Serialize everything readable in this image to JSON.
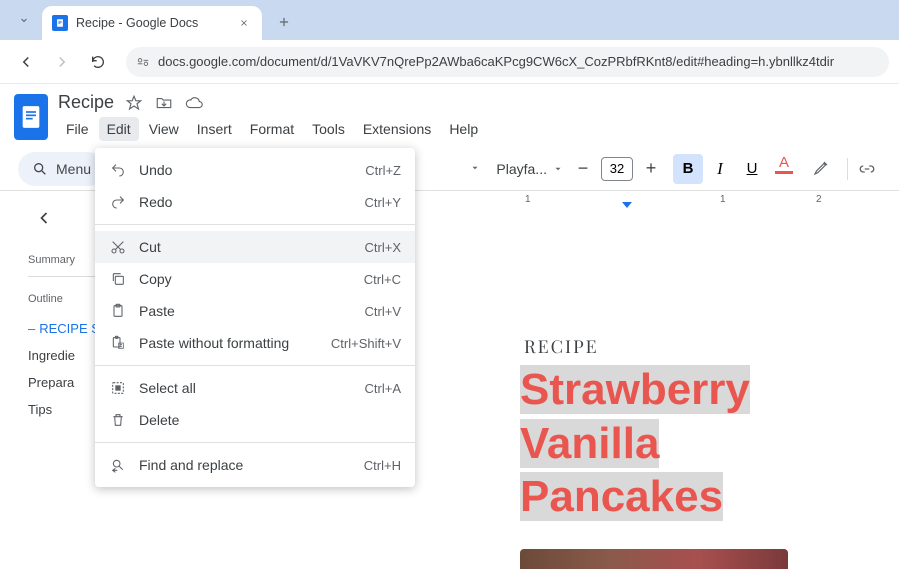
{
  "browser": {
    "tab_title": "Recipe - Google Docs",
    "url": "docs.google.com/document/d/1VaVKV7nQrePp2AWba6caKPcg9CW6cX_CozPRbfRKnt8/edit#heading=h.ybnllkz4tdir"
  },
  "docs": {
    "title": "Recipe",
    "menus": [
      "File",
      "Edit",
      "View",
      "Insert",
      "Format",
      "Tools",
      "Extensions",
      "Help"
    ],
    "active_menu_index": 1,
    "menus_pill_label": "Menu"
  },
  "toolbar": {
    "font_name": "Playfa...",
    "font_size": "32",
    "bold": "B",
    "italic": "I",
    "underline": "U",
    "text_color_letter": "A"
  },
  "edit_menu": {
    "sections": [
      [
        {
          "icon": "undo-icon",
          "label": "Undo",
          "shortcut": "Ctrl+Z"
        },
        {
          "icon": "redo-icon",
          "label": "Redo",
          "shortcut": "Ctrl+Y"
        }
      ],
      [
        {
          "icon": "cut-icon",
          "label": "Cut",
          "shortcut": "Ctrl+X",
          "hover": true
        },
        {
          "icon": "copy-icon",
          "label": "Copy",
          "shortcut": "Ctrl+C"
        },
        {
          "icon": "paste-icon",
          "label": "Paste",
          "shortcut": "Ctrl+V"
        },
        {
          "icon": "paste-plain-icon",
          "label": "Paste without formatting",
          "shortcut": "Ctrl+Shift+V"
        }
      ],
      [
        {
          "icon": "select-all-icon",
          "label": "Select all",
          "shortcut": "Ctrl+A"
        },
        {
          "icon": "delete-icon",
          "label": "Delete",
          "shortcut": ""
        }
      ],
      [
        {
          "icon": "find-replace-icon",
          "label": "Find and replace",
          "shortcut": "Ctrl+H"
        }
      ]
    ]
  },
  "outline": {
    "summary_label": "Summary",
    "outline_label": "Outline",
    "items": [
      {
        "label": "RECIPE S",
        "active": true
      },
      {
        "label": "Ingredie",
        "active": false
      },
      {
        "label": "Prepara",
        "active": false
      },
      {
        "label": "Tips",
        "active": false
      }
    ]
  },
  "ruler": {
    "marks": [
      "1",
      "1",
      "2"
    ]
  },
  "document": {
    "eyebrow": "RECIPE",
    "title_lines": [
      "Strawberry",
      "Vanilla",
      "Pancakes"
    ]
  }
}
